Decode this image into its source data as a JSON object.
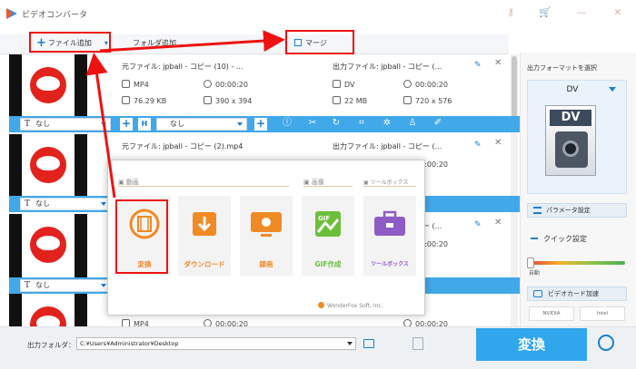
{
  "app": {
    "title": "ビデオコンバータ"
  },
  "toolbar": {
    "add_file_label": "ファイル追加",
    "add_folder_label": "フォルダ追加",
    "merge_label": "マージ"
  },
  "files": [
    {
      "source_name": "元ファイル: jpball - コピー (10) - ...",
      "output_name": "出力ファイル: jpball - コピー (...",
      "src_format": "MP4",
      "src_duration": "00:00:20",
      "src_size": "76.29 KB",
      "src_resolution": "390 x 394",
      "out_format": "DV",
      "out_duration": "00:00:20",
      "out_size": "22 MB",
      "out_resolution": "720 x 576",
      "subtitle": "なし",
      "audio": "なし"
    },
    {
      "source_name": "元ファイル: jpball - コピー (2).mp4",
      "output_name": "出力ファイル: jpball - コピー (...",
      "out_duration": "00:00:20",
      "subtitle": "なし"
    },
    {
      "output_name": "出力ファイル: jpball - コピー (...",
      "out_duration": "00:00:20",
      "subtitle": "なし"
    },
    {
      "src_format": "MP4",
      "src_duration": "00:00:20",
      "out_duration": "00:00:20"
    }
  ],
  "right_panel": {
    "output_format_label": "出力フォーマットを選択",
    "format_name": "DV",
    "format_icon_text": "DV",
    "param_label": "パラメータ設定",
    "quick_label": "クイック設定",
    "speed_label": "自動",
    "gpu_label": "ビデオカード加速",
    "vendors": [
      "NVIDIA",
      "Intel"
    ]
  },
  "popup": {
    "section_video": "動画",
    "section_image": "画像",
    "section_toolbox": "ツールボックス",
    "tiles": [
      {
        "label": "変換",
        "icon": "film-reel-icon",
        "color": "#f08a24"
      },
      {
        "label": "ダウンロード",
        "icon": "download-icon",
        "color": "#f08a24"
      },
      {
        "label": "録画",
        "icon": "screen-record-icon",
        "color": "#f08a24"
      },
      {
        "label": "GIF作成",
        "icon": "gif-image-icon",
        "color": "#6cbf3a"
      },
      {
        "label": "ツールボックス",
        "icon": "toolbox-icon",
        "color": "#8e5cc4"
      }
    ],
    "copyright": "WonderFox Soft, Inc."
  },
  "bottom": {
    "output_folder_label": "出力フォルダ：",
    "output_path": "C:¥Users¥Administrator¥Desktop",
    "convert_label": "変換"
  },
  "colors": {
    "accent": "#41a8ea",
    "convert": "#30a6ec",
    "highlight_red": "#e11111",
    "orange": "#f08a24"
  }
}
